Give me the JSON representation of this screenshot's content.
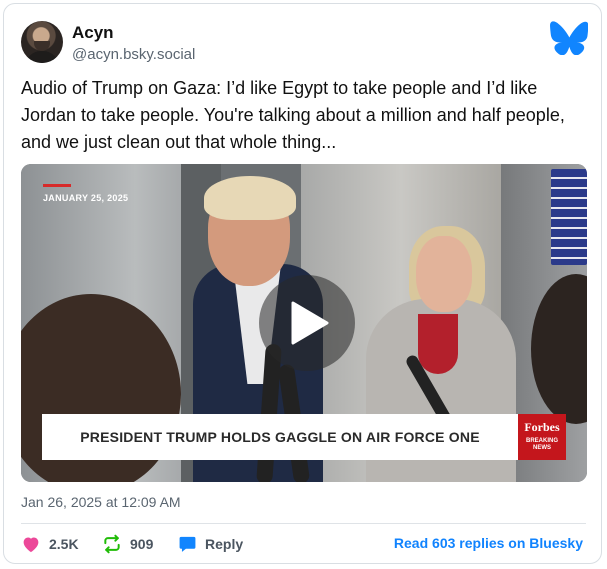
{
  "post": {
    "author": {
      "display_name": "Acyn",
      "handle": "@acyn.bsky.social",
      "avatar_icon": "user-avatar"
    },
    "brand_icon": "bluesky-butterfly-icon",
    "brand_color": "#1185fe",
    "text": "Audio of Trump on Gaza: I’d like Egypt to take people and I’d like Jordan to take people. You're talking about a million and half people, and we just clean out that whole thing...",
    "media": {
      "type": "video",
      "overlay_date": "JANUARY 25, 2025",
      "lower_third": "PRESIDENT TRUMP HOLDS GAGGLE ON AIR FORCE ONE",
      "network_logo": "Forbes",
      "network_tag_line1": "BREAKING",
      "network_tag_line2": "NEWS",
      "play_icon": "play-icon"
    },
    "timestamp": "Jan 26, 2025 at 12:09 AM",
    "actions": {
      "likes": "2.5K",
      "reposts": "909",
      "reply_label": "Reply",
      "read_replies": "Read 603 replies on Bluesky"
    },
    "colors": {
      "like": "#ec4899",
      "repost": "#20bc07",
      "reply": "#1185fe",
      "link": "#1083fe"
    }
  }
}
